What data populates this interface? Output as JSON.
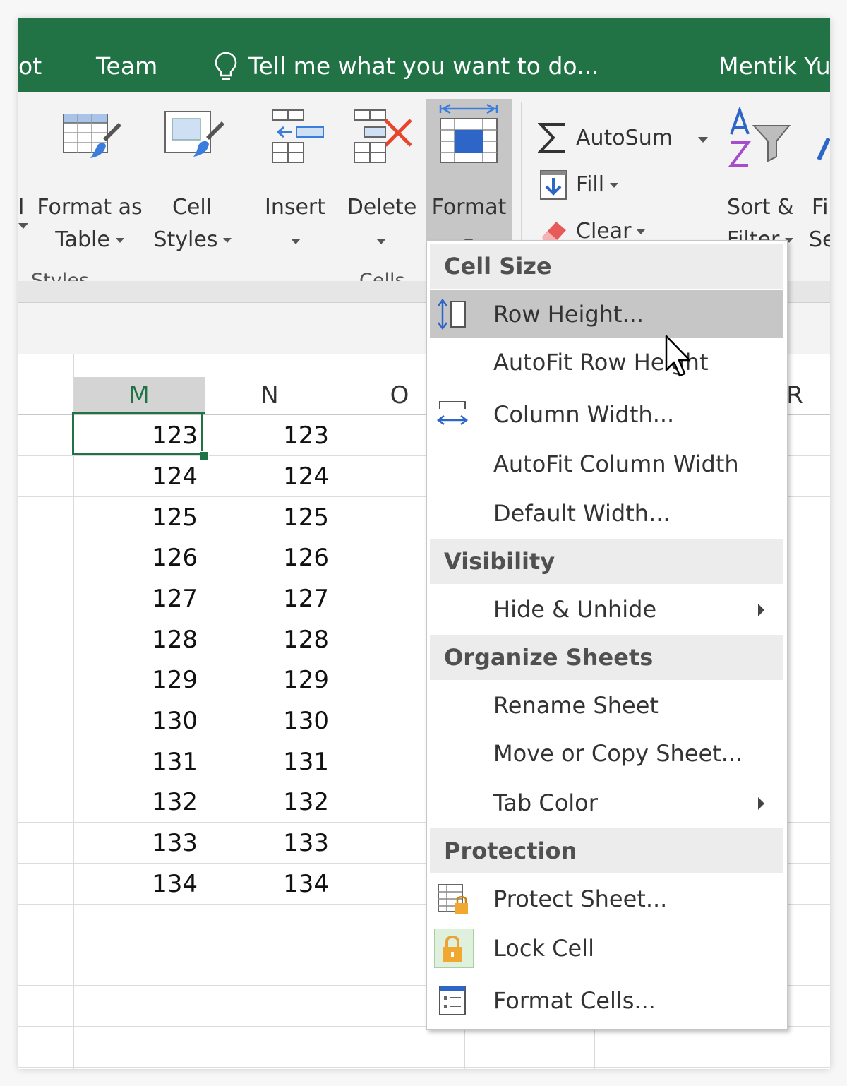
{
  "titlebar": {
    "tab_partial": "ot",
    "tab_team": "Team",
    "tell_me": "Tell me what you want to do...",
    "user": "Mentik Yu"
  },
  "ribbon": {
    "styles_group": {
      "partial_cut": "l",
      "format_as_table_line1": "Format as",
      "format_as_table_line2": "Table",
      "cell_styles_line1": "Cell",
      "cell_styles_line2": "Styles",
      "group_label": "Styles"
    },
    "cells_group": {
      "insert": "Insert",
      "delete": "Delete",
      "format": "Format",
      "group_label": "Cells"
    },
    "editing_group": {
      "autosum": "AutoSum",
      "fill": "Fill",
      "clear": "Clear",
      "sort_filter_line1": "Sort &",
      "sort_filter_line2": "Filter",
      "find_partial_line1": "Fi",
      "find_partial_line2": "Se"
    }
  },
  "grid": {
    "columns": [
      "M",
      "N",
      "O",
      "R"
    ],
    "selected_column": "M",
    "rows": [
      {
        "m": "123",
        "n": "123"
      },
      {
        "m": "124",
        "n": "124"
      },
      {
        "m": "125",
        "n": "125"
      },
      {
        "m": "126",
        "n": "126"
      },
      {
        "m": "127",
        "n": "127"
      },
      {
        "m": "128",
        "n": "128"
      },
      {
        "m": "129",
        "n": "129"
      },
      {
        "m": "130",
        "n": "130"
      },
      {
        "m": "131",
        "n": "131"
      },
      {
        "m": "132",
        "n": "132"
      },
      {
        "m": "133",
        "n": "133"
      },
      {
        "m": "134",
        "n": "134"
      }
    ]
  },
  "format_menu": {
    "cell_size_header": "Cell Size",
    "row_height": "Row Height...",
    "autofit_row_height": "AutoFit Row Height",
    "column_width": "Column Width...",
    "autofit_column_width": "AutoFit Column Width",
    "default_width": "Default Width...",
    "visibility_header": "Visibility",
    "hide_unhide": "Hide & Unhide",
    "organize_header": "Organize Sheets",
    "rename_sheet": "Rename Sheet",
    "move_copy_sheet": "Move or Copy Sheet...",
    "tab_color": "Tab Color",
    "protection_header": "Protection",
    "protect_sheet": "Protect Sheet...",
    "lock_cell": "Lock Cell",
    "format_cells": "Format Cells..."
  },
  "colors": {
    "excel_green": "#217346",
    "menu_hover": "#c6c6c6",
    "header_gray": "#ececec",
    "lock_orange": "#f0a830"
  }
}
